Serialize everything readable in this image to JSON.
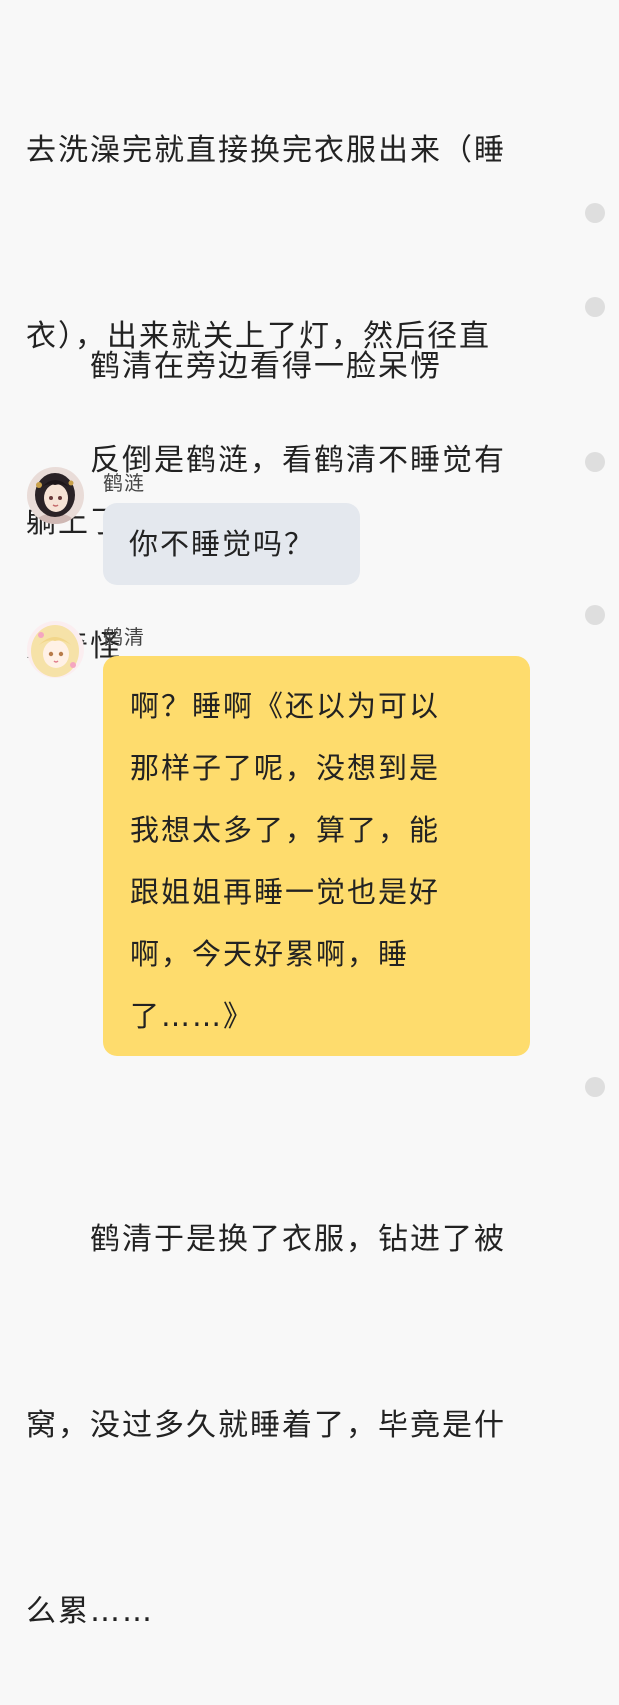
{
  "story": {
    "para_1": "去洗澡完就直接换完衣服出来（睡衣），出来就关上了灯，然后径直躺上了床，睡觉",
    "para_1_lines": [
      "去洗澡完就直接换完衣服出来（睡",
      "衣），出来就关上了灯，然后径直",
      "躺上了床，睡觉"
    ],
    "para_2": "　　鹤清在旁边看得一脸呆愣",
    "para_3_lines": [
      "　　反倒是鹤涟，看鹤清不睡觉有",
      "点奇怪"
    ],
    "para_4_lines": [
      "　　鹤清于是换了衣服，钻进了被",
      "窝，没过多久就睡着了，毕竟是什",
      "么累……"
    ]
  },
  "chat": [
    {
      "speaker": "鹤涟",
      "avatar": "girl-dark-hair-avatar",
      "bubble_color": "#e4e8ee",
      "lines": [
        "你不睡觉吗？"
      ]
    },
    {
      "speaker": "鹤清",
      "avatar": "girl-blonde-hair-avatar",
      "bubble_color": "#fedc6d",
      "lines": [
        "啊？睡啊《还以为可以",
        "那样子了呢，没想到是",
        "我想太多了，算了，能",
        "跟姐姐再睡一觉也是好",
        "啊，今天好累啊，睡",
        "了……》"
      ]
    }
  ],
  "colors": {
    "background": "#f8f8f8",
    "dot": "#dedede"
  }
}
